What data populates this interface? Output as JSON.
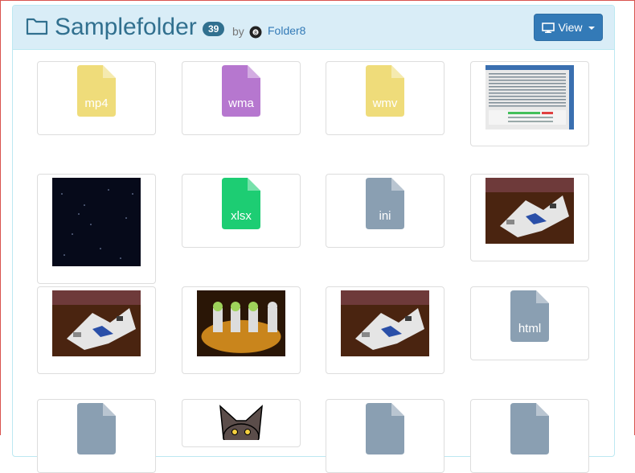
{
  "header": {
    "title": "Samplefolder",
    "count": "39",
    "by_label": "by",
    "owner": "Folder8",
    "view_button": "View"
  },
  "colors": {
    "mp4": "#efdc7a",
    "wma": "#b677cf",
    "wmv": "#efdc7a",
    "xlsx": "#1dcd73",
    "ini": "#8a9fb2",
    "html": "#8a9fb2",
    "generic": "#8a9fb2"
  },
  "files": [
    {
      "type": "mp4",
      "label": "mp4"
    },
    {
      "type": "wma",
      "label": "wma"
    },
    {
      "type": "wmv",
      "label": "wmv"
    },
    {
      "type": "image",
      "label": "",
      "image": "screenshot"
    },
    {
      "type": "image",
      "label": "",
      "image": "dark-starfield"
    },
    {
      "type": "xlsx",
      "label": "xlsx"
    },
    {
      "type": "ini",
      "label": "ini"
    },
    {
      "type": "image",
      "label": "",
      "image": "lego-spaceship"
    },
    {
      "type": "image",
      "label": "",
      "image": "lego-spaceship"
    },
    {
      "type": "image",
      "label": "",
      "image": "lego-minifigures"
    },
    {
      "type": "image",
      "label": "",
      "image": "lego-spaceship"
    },
    {
      "type": "html",
      "label": "html"
    },
    {
      "type": "generic",
      "label": ""
    },
    {
      "type": "image",
      "label": "",
      "image": "cat-avatar"
    },
    {
      "type": "generic",
      "label": ""
    },
    {
      "type": "generic",
      "label": ""
    }
  ]
}
